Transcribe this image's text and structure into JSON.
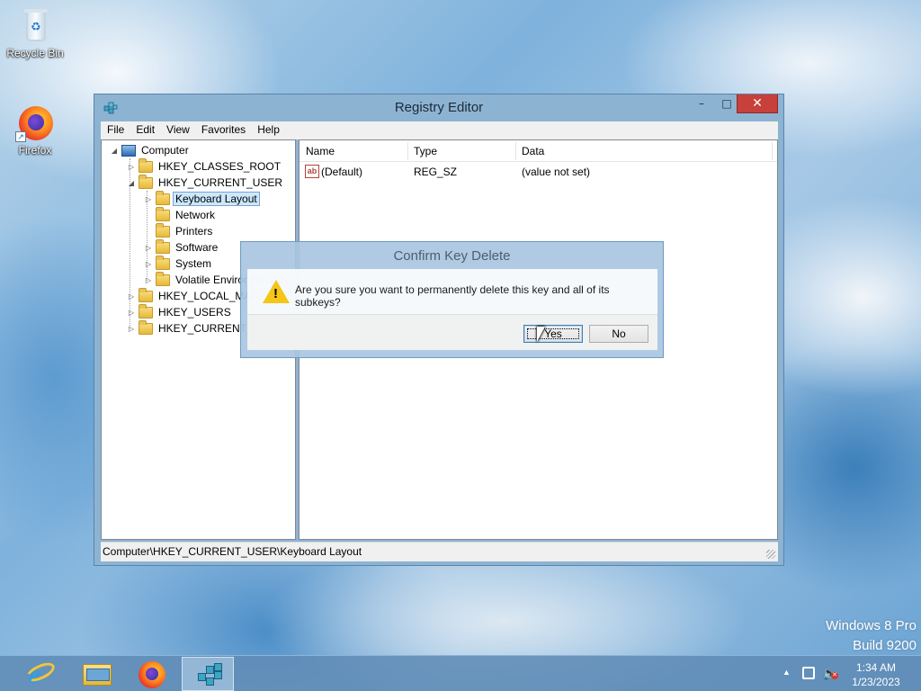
{
  "desktop": {
    "icons": [
      {
        "label": "Recycle Bin",
        "icon": "recycle-bin-icon"
      },
      {
        "label": "Firefox",
        "icon": "firefox-icon"
      }
    ],
    "watermark": {
      "line1": "Windows 8 Pro",
      "line2": "Build 9200"
    }
  },
  "window": {
    "title": "Registry Editor",
    "controls": {
      "minimize": "–",
      "maximize": "□",
      "close": "✕"
    },
    "menu": [
      "File",
      "Edit",
      "View",
      "Favorites",
      "Help"
    ],
    "tree": {
      "root": "Computer",
      "items": [
        {
          "label": "HKEY_CLASSES_ROOT",
          "level": 1,
          "expander": "▷"
        },
        {
          "label": "HKEY_CURRENT_USER",
          "level": 1,
          "expander": "◢"
        },
        {
          "label": "Keyboard Layout",
          "level": 2,
          "expander": "▷",
          "selected": true
        },
        {
          "label": "Network",
          "level": 2,
          "expander": ""
        },
        {
          "label": "Printers",
          "level": 2,
          "expander": ""
        },
        {
          "label": "Software",
          "level": 2,
          "expander": "▷"
        },
        {
          "label": "System",
          "level": 2,
          "expander": "▷"
        },
        {
          "label": "Volatile Environment",
          "level": 2,
          "expander": "▷"
        },
        {
          "label": "HKEY_LOCAL_MACHINE",
          "level": 1,
          "expander": "▷"
        },
        {
          "label": "HKEY_USERS",
          "level": 1,
          "expander": "▷"
        },
        {
          "label": "HKEY_CURRENT_CONFIG",
          "level": 1,
          "expander": "▷"
        }
      ]
    },
    "list": {
      "columns": [
        "Name",
        "Type",
        "Data"
      ],
      "rows": [
        {
          "icon_text": "ab",
          "name": "(Default)",
          "type": "REG_SZ",
          "data": "(value not set)"
        }
      ]
    },
    "status": "Computer\\HKEY_CURRENT_USER\\Keyboard Layout"
  },
  "dialog": {
    "title": "Confirm Key Delete",
    "message": "Are you sure you want to permanently delete this key and all of its subkeys?",
    "icon_mark": "!",
    "yes_label": "Yes",
    "no_label": "No"
  },
  "taskbar": {
    "apps": [
      {
        "name": "Internet Explorer",
        "icon": "internet-explorer-icon"
      },
      {
        "name": "File Explorer",
        "icon": "file-explorer-icon"
      },
      {
        "name": "Firefox",
        "icon": "firefox-icon"
      },
      {
        "name": "Registry Editor",
        "icon": "regedit-icon",
        "active": true
      }
    ],
    "tray": {
      "chevron": "▲",
      "time": "1:34 AM",
      "date": "1/23/2023"
    }
  }
}
